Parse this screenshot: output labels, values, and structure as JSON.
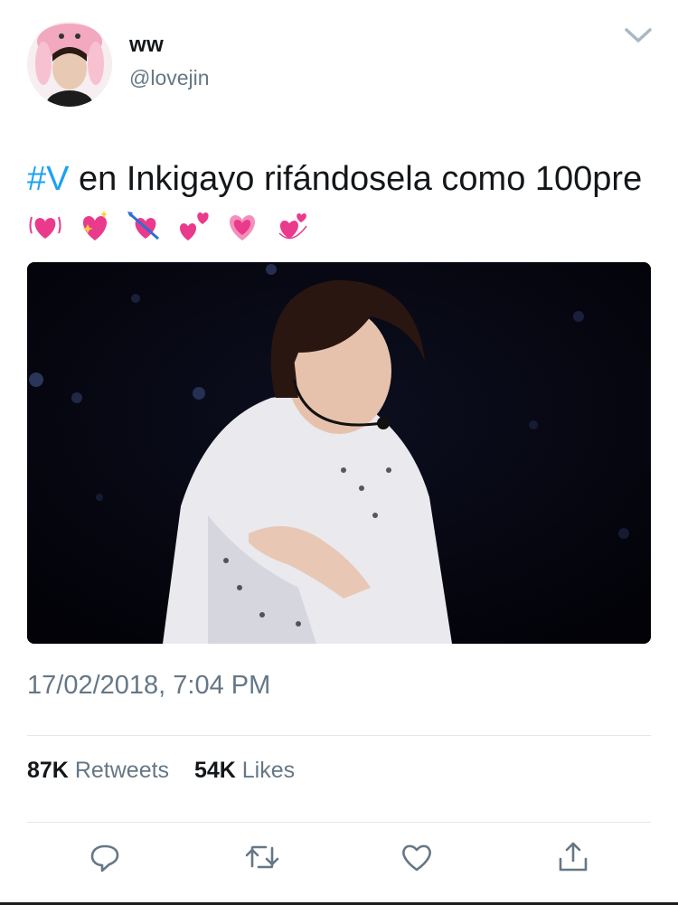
{
  "user": {
    "display_name": "ww",
    "handle": "@lovejin",
    "avatar_icon": "profile-photo-with-pink-hat"
  },
  "tweet": {
    "hashtag": "#V",
    "text_after_hashtag": " en Inkigayo rifándosela como 100pre",
    "emojis": [
      "vibrating-heart",
      "sparkling-heart",
      "heart-with-arrow",
      "two-hearts",
      "growing-heart",
      "revolving-hearts"
    ],
    "media_icon": "concert-photo"
  },
  "timestamp": "17/02/2018, 7:04 PM",
  "stats": {
    "retweets_count": "87K",
    "retweets_label": "Retweets",
    "likes_count": "54K",
    "likes_label": "Likes"
  },
  "actions": {
    "reply_icon": "reply-icon",
    "retweet_icon": "retweet-icon",
    "like_icon": "heart-icon",
    "share_icon": "share-icon"
  },
  "colors": {
    "hashtag": "#1da1f2",
    "secondary_text": "#657786",
    "primary_text": "#14171a",
    "heart_pink": "#ea3a8c"
  }
}
